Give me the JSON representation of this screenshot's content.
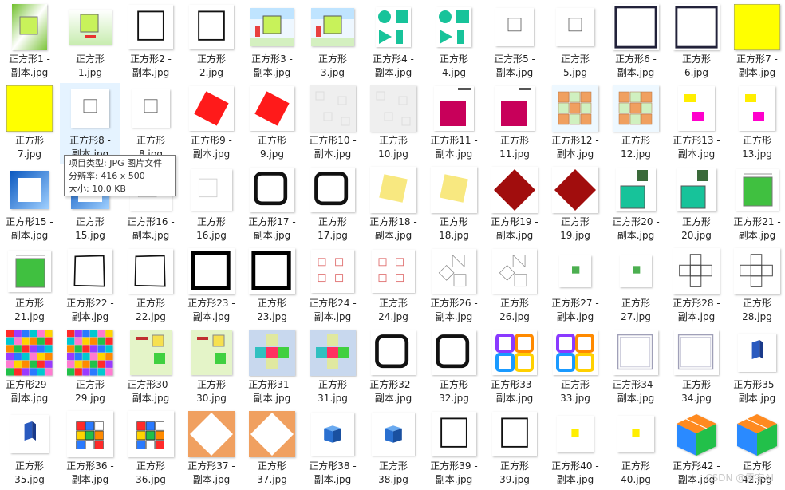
{
  "files": [
    {
      "label": "正方形1 -\n副本.jpg",
      "icon": "lime-gradient-square-thumb"
    },
    {
      "label": "正方形\n1.jpg",
      "icon": "lime-square-caption-thumb"
    },
    {
      "label": "正方形2 -\n副本.jpg",
      "icon": "outline-square-thumb"
    },
    {
      "label": "正方形\n2.jpg",
      "icon": "outline-square-thumb"
    },
    {
      "label": "正方形3 -\n副本.jpg",
      "icon": "lime-square-blue-bg-thumb"
    },
    {
      "label": "正方形\n3.jpg",
      "icon": "lime-square-blue-bg-thumb"
    },
    {
      "label": "正方形4 -\n副本.jpg",
      "icon": "teal-shapes-thumb"
    },
    {
      "label": "正方形\n4.jpg",
      "icon": "teal-shapes-thumb"
    },
    {
      "label": "正方形5 -\n副本.jpg",
      "icon": "small-outline-square-thumb"
    },
    {
      "label": "正方形\n5.jpg",
      "icon": "small-outline-square-thumb"
    },
    {
      "label": "正方形6 -\n副本.jpg",
      "icon": "navy-outline-square-thumb"
    },
    {
      "label": "正方形\n6.jpg",
      "icon": "navy-outline-square-thumb"
    },
    {
      "label": "正方形7 -\n副本.jpg",
      "icon": "yellow-square-thumb"
    },
    {
      "label": "正方形\n7.jpg",
      "icon": "yellow-square-thumb"
    },
    {
      "label": "正方形8 -\n副本.jpg",
      "icon": "small-outline-square-thumb"
    },
    {
      "label": "正方形\n8.jpg",
      "icon": "small-outline-square-thumb"
    },
    {
      "label": "正方形9 -\n副本.jpg",
      "icon": "red-rotated-square-thumb"
    },
    {
      "label": "正方形\n9.jpg",
      "icon": "red-rotated-square-thumb"
    },
    {
      "label": "正方形10 -\n副本.jpg",
      "icon": "gray-pattern-thumb"
    },
    {
      "label": "正方形\n10.jpg",
      "icon": "gray-pattern-thumb"
    },
    {
      "label": "正方形11 -\n副本.jpg",
      "icon": "crimson-square-thumb"
    },
    {
      "label": "正方形\n11.jpg",
      "icon": "crimson-square-thumb"
    },
    {
      "label": "正方形12 -\n副本.jpg",
      "icon": "orange-checker-thumb"
    },
    {
      "label": "正方形\n12.jpg",
      "icon": "orange-checker-thumb"
    },
    {
      "label": "正方形13 -\n副本.jpg",
      "icon": "yellow-magenta-thumb"
    },
    {
      "label": "正方形\n13.jpg",
      "icon": "yellow-magenta-thumb"
    },
    {
      "label": "正方形15 -\n副本.jpg",
      "icon": "blue-frame-thumb"
    },
    {
      "label": "正方形\n15.jpg",
      "icon": "blue-frame-thumb"
    },
    {
      "label": "正方形16 -\n副本.jpg",
      "icon": "faint-square-thumb"
    },
    {
      "label": "正方形\n16.jpg",
      "icon": "faint-square-thumb"
    },
    {
      "label": "正方形17 -\n副本.jpg",
      "icon": "rounded-outline-square-thumb"
    },
    {
      "label": "正方形\n17.jpg",
      "icon": "rounded-outline-square-thumb"
    },
    {
      "label": "正方形18 -\n副本.jpg",
      "icon": "pale-yellow-square-thumb"
    },
    {
      "label": "正方形\n18.jpg",
      "icon": "pale-yellow-square-thumb"
    },
    {
      "label": "正方形19 -\n副本.jpg",
      "icon": "dark-red-diamond-thumb"
    },
    {
      "label": "正方形\n19.jpg",
      "icon": "dark-red-diamond-thumb"
    },
    {
      "label": "正方形20 -\n副本.jpg",
      "icon": "teal-square-photo-thumb"
    },
    {
      "label": "正方形\n20.jpg",
      "icon": "teal-square-photo-thumb"
    },
    {
      "label": "正方形21 -\n副本.jpg",
      "icon": "green-square-measure-thumb"
    },
    {
      "label": "正方形\n21.jpg",
      "icon": "green-square-measure-thumb"
    },
    {
      "label": "正方形22 -\n副本.jpg",
      "icon": "sketch-square-thumb"
    },
    {
      "label": "正方形\n22.jpg",
      "icon": "sketch-square-thumb"
    },
    {
      "label": "正方形23 -\n副本.jpg",
      "icon": "thick-outline-square-thumb"
    },
    {
      "label": "正方形\n23.jpg",
      "icon": "thick-outline-square-thumb"
    },
    {
      "label": "正方形24 -\n副本.jpg",
      "icon": "pink-small-squares-thumb"
    },
    {
      "label": "正方形\n24.jpg",
      "icon": "pink-small-squares-thumb"
    },
    {
      "label": "正方形26 -\n副本.jpg",
      "icon": "geometry-diagram-thumb"
    },
    {
      "label": "正方形\n26.jpg",
      "icon": "geometry-diagram-thumb"
    },
    {
      "label": "正方形27 -\n副本.jpg",
      "icon": "small-green-square-thumb"
    },
    {
      "label": "正方形\n27.jpg",
      "icon": "small-green-square-thumb"
    },
    {
      "label": "正方形28 -\n副本.jpg",
      "icon": "cube-net-thumb"
    },
    {
      "label": "正方形\n28.jpg",
      "icon": "cube-net-thumb"
    },
    {
      "label": "正方形29 -\n副本.jpg",
      "icon": "colorful-mosaic-thumb"
    },
    {
      "label": "正方形\n29.jpg",
      "icon": "colorful-mosaic-thumb"
    },
    {
      "label": "正方形30 -\n副本.jpg",
      "icon": "cube-lesson-thumb"
    },
    {
      "label": "正方形\n30.jpg",
      "icon": "cube-lesson-thumb"
    },
    {
      "label": "正方形31 -\n副本.jpg",
      "icon": "color-cross-thumb"
    },
    {
      "label": "正方形\n31.jpg",
      "icon": "color-cross-thumb"
    },
    {
      "label": "正方形32 -\n副本.jpg",
      "icon": "rounded-outline-square-thumb"
    },
    {
      "label": "正方形\n32.jpg",
      "icon": "rounded-outline-square-thumb"
    },
    {
      "label": "正方形33 -\n副本.jpg",
      "icon": "colorful-frames-thumb"
    },
    {
      "label": "正方形\n33.jpg",
      "icon": "colorful-frames-thumb"
    },
    {
      "label": "正方形34 -\n副本.jpg",
      "icon": "ornate-frame-thumb"
    },
    {
      "label": "正方形\n34.jpg",
      "icon": "ornate-frame-thumb"
    },
    {
      "label": "正方形35 -\n副本.jpg",
      "icon": "blue-cuboid-thumb"
    },
    {
      "label": "正方形\n35.jpg",
      "icon": "blue-cuboid-thumb"
    },
    {
      "label": "正方形36 -\n副本.jpg",
      "icon": "rubik-cube-thumb"
    },
    {
      "label": "正方形\n36.jpg",
      "icon": "rubik-cube-thumb"
    },
    {
      "label": "正方形37 -\n副本.jpg",
      "icon": "orange-diamond-frame-thumb"
    },
    {
      "label": "正方形\n37.jpg",
      "icon": "orange-diamond-frame-thumb"
    },
    {
      "label": "正方形38 -\n副本.jpg",
      "icon": "blue-cube-thumb"
    },
    {
      "label": "正方形\n38.jpg",
      "icon": "blue-cube-thumb"
    },
    {
      "label": "正方形39 -\n副本.jpg",
      "icon": "outline-square-thumb"
    },
    {
      "label": "正方形\n39.jpg",
      "icon": "outline-square-thumb"
    },
    {
      "label": "正方形40 -\n副本.jpg",
      "icon": "small-yellow-square-thumb"
    },
    {
      "label": "正方形\n40.jpg",
      "icon": "small-yellow-square-thumb"
    },
    {
      "label": "正方形42 -\n副本.jpg",
      "icon": "color-cube-thumb"
    },
    {
      "label": "正方形\n42.jpg",
      "icon": "color-cube-thumb"
    }
  ],
  "selected_label": "正方形8 -\n副本.jpg",
  "tooltip": {
    "type_line": "项目类型: JPG 图片文件",
    "resolution_line": "分辨率: 416 x 500",
    "size_line": "大小: 10.0 KB"
  },
  "watermark": "CSDN @雷宇AI",
  "colors": {
    "selection": "#e5f3ff",
    "lime": "#c8f25a",
    "teal": "#17c39a",
    "red": "#ff1a1a",
    "dark_red": "#a10d0d",
    "yellow": "#ffff00",
    "crimson": "#c8005a",
    "orange": "#f0a060"
  }
}
